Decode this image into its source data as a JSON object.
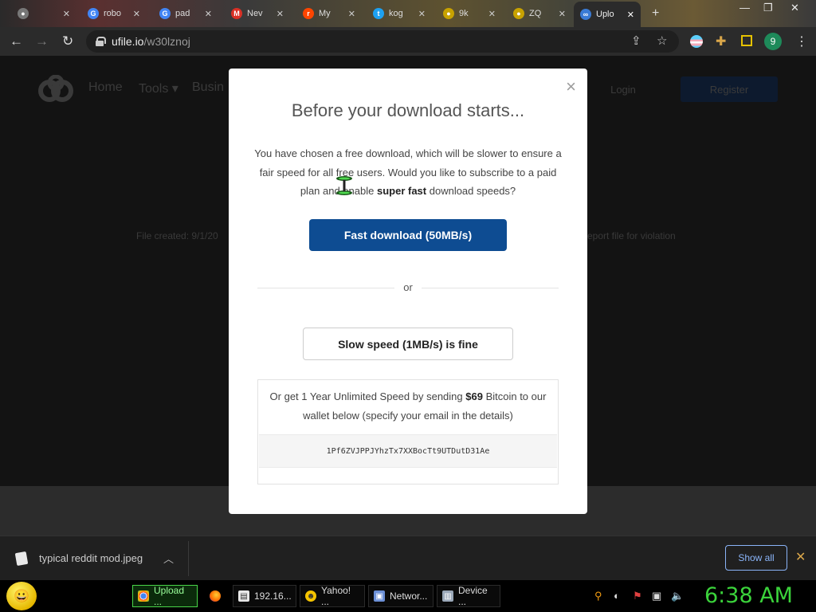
{
  "browser": {
    "tabs": [
      {
        "label": "",
        "icon": "chrome-icon",
        "color": "#777777"
      },
      {
        "label": "robo",
        "icon": "google-icon",
        "color": "#4285f4"
      },
      {
        "label": "pad",
        "icon": "google-icon",
        "color": "#4285f4"
      },
      {
        "label": "Nev",
        "icon": "gmail-icon",
        "color": "#d93025"
      },
      {
        "label": "My",
        "icon": "reddit-icon",
        "color": "#ff4500"
      },
      {
        "label": "kog",
        "icon": "twitter-icon",
        "color": "#1da1f2"
      },
      {
        "label": "9k",
        "icon": "generic-icon",
        "color": "#c8a200"
      },
      {
        "label": "ZQ",
        "icon": "generic-icon",
        "color": "#c8a200"
      },
      {
        "label": "Uplo",
        "icon": "ufile-icon",
        "color": "#3a7bd5"
      }
    ],
    "new_tab": "+",
    "url_host": "ufile.io",
    "url_path": "/w30lznoj",
    "profile_initial": "9"
  },
  "site": {
    "nav": [
      "Home",
      "Tools ▾",
      "Busin"
    ],
    "login": "Login",
    "register": "Register",
    "file_created": "File created: 9/1/20",
    "report": "eport file for violation"
  },
  "modal": {
    "close": "×",
    "title": "Before your download starts...",
    "text_1": "You have chosen a free download, which will be slower to ensure a fair speed for all free users. Would you like to subscribe to a paid plan and enable ",
    "text_bold": "super fast",
    "text_2": " download speeds?",
    "fast_button": "Fast download (50MB/s)",
    "or": "or",
    "slow_button": "Slow speed (1MB/s) is fine",
    "btc_1": "Or get 1 Year Unlimited Speed by sending ",
    "btc_price": "$69",
    "btc_2": " Bitcoin to our wallet below (specify your email in the details)",
    "btc_address": "1Pf6ZVJPPJYhzTx7XXBocTt9UTDutD31Ae"
  },
  "downloads": {
    "file_name": "typical reddit mod.jpeg",
    "show_all": "Show all"
  },
  "taskbar": {
    "tasks": [
      {
        "label": "Upload ...",
        "icon": "chrome-icon",
        "active": true
      },
      {
        "label": "",
        "icon": "firefox-icon",
        "active": false
      },
      {
        "label": "192.16...",
        "icon": "document-icon",
        "active": false
      },
      {
        "label": "Yahoo! ...",
        "icon": "yahoo-icon",
        "active": false
      },
      {
        "label": "Networ...",
        "icon": "network-icon",
        "active": false
      },
      {
        "label": "Device ...",
        "icon": "device-manager-icon",
        "active": false
      }
    ],
    "clock": "6:38 AM"
  }
}
